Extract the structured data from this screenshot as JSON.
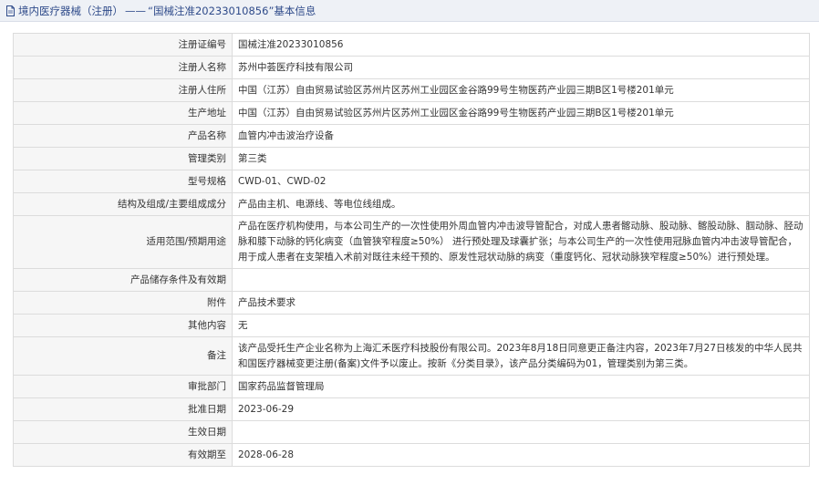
{
  "header": {
    "prefix": "境内医疗器械（注册）",
    "separator": "——",
    "title": "“国械注准20233010856”基本信息",
    "icon": "document-icon"
  },
  "rows": [
    {
      "label": "注册证编号",
      "value": "国械注准20233010856"
    },
    {
      "label": "注册人名称",
      "value": "苏州中荟医疗科技有限公司"
    },
    {
      "label": "注册人住所",
      "value": "中国（江苏）自由贸易试验区苏州片区苏州工业园区金谷路99号生物医药产业园三期B区1号楼201单元"
    },
    {
      "label": "生产地址",
      "value": "中国（江苏）自由贸易试验区苏州片区苏州工业园区金谷路99号生物医药产业园三期B区1号楼201单元"
    },
    {
      "label": "产品名称",
      "value": "血管内冲击波治疗设备"
    },
    {
      "label": "管理类别",
      "value": "第三类"
    },
    {
      "label": "型号规格",
      "value": "CWD-01、CWD-02"
    },
    {
      "label": "结构及组成/主要组成成分",
      "value": "产品由主机、电源线、等电位线组成。"
    },
    {
      "label": "适用范围/预期用途",
      "value": "产品在医疗机构使用，与本公司生产的一次性使用外周血管内冲击波导管配合，对成人患者髂动脉、股动脉、髂股动脉、腘动脉、胫动脉和膝下动脉的钙化病变（血管狭窄程度≥50%） 进行预处理及球囊扩张；与本公司生产的一次性使用冠脉血管内冲击波导管配合，用于成人患者在支架植入术前对既往未经干预的、原发性冠状动脉的病变（重度钙化、冠状动脉狭窄程度≥50%）进行预处理。"
    },
    {
      "label": "产品储存条件及有效期",
      "value": ""
    },
    {
      "label": "附件",
      "value": "产品技术要求"
    },
    {
      "label": "其他内容",
      "value": "无"
    },
    {
      "label": "备注",
      "value": "该产品受托生产企业名称为上海汇禾医疗科技股份有限公司。2023年8月18日同意更正备注内容，2023年7月27日核发的中华人民共和国医疗器械变更注册(备案)文件予以废止。按新《分类目录》，该产品分类编码为01，管理类别为第三类。"
    },
    {
      "label": "审批部门",
      "value": "国家药品监督管理局"
    },
    {
      "label": "批准日期",
      "value": "2023-06-29"
    },
    {
      "label": "生效日期",
      "value": ""
    },
    {
      "label": "有效期至",
      "value": "2028-06-28"
    }
  ]
}
